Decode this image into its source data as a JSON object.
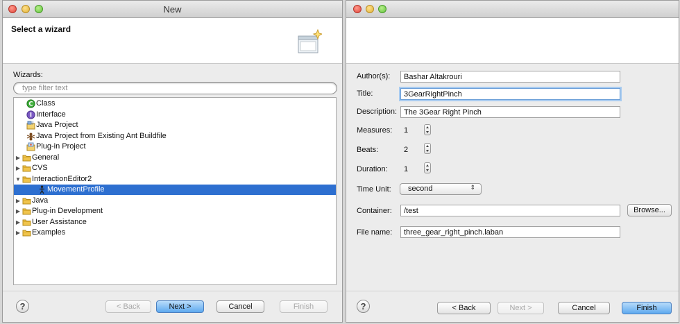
{
  "left_window": {
    "title": "New",
    "banner_title": "Select a wizard",
    "wizards_label": "Wizards:",
    "filter_placeholder": "type filter text",
    "tree": [
      {
        "label": "Class",
        "icon": "class-icon",
        "level": 1,
        "expander": "none",
        "selected": false
      },
      {
        "label": "Interface",
        "icon": "interface-icon",
        "level": 1,
        "expander": "none",
        "selected": false
      },
      {
        "label": "Java Project",
        "icon": "java-project-icon",
        "level": 1,
        "expander": "none",
        "selected": false
      },
      {
        "label": "Java Project from Existing Ant Buildfile",
        "icon": "ant-project-icon",
        "level": 1,
        "expander": "none",
        "selected": false
      },
      {
        "label": "Plug-in Project",
        "icon": "plugin-project-icon",
        "level": 1,
        "expander": "none",
        "selected": false
      },
      {
        "label": "General",
        "icon": "folder-icon",
        "level": 0,
        "expander": "collapsed",
        "selected": false
      },
      {
        "label": "CVS",
        "icon": "folder-icon",
        "level": 0,
        "expander": "collapsed",
        "selected": false
      },
      {
        "label": "InteractionEditor2",
        "icon": "folder-icon",
        "level": 0,
        "expander": "expanded",
        "selected": false
      },
      {
        "label": "MovementProfile",
        "icon": "figure-icon",
        "level": 2,
        "expander": "none",
        "selected": true
      },
      {
        "label": "Java",
        "icon": "folder-icon",
        "level": 0,
        "expander": "collapsed",
        "selected": false
      },
      {
        "label": "Plug-in Development",
        "icon": "folder-icon",
        "level": 0,
        "expander": "collapsed",
        "selected": false
      },
      {
        "label": "User Assistance",
        "icon": "folder-icon",
        "level": 0,
        "expander": "collapsed",
        "selected": false
      },
      {
        "label": "Examples",
        "icon": "folder-icon",
        "level": 0,
        "expander": "collapsed",
        "selected": false
      }
    ],
    "buttons": {
      "help": "?",
      "back": "< Back",
      "next": "Next >",
      "cancel": "Cancel",
      "finish": "Finish"
    }
  },
  "right_window": {
    "fields": {
      "author_label": "Author(s):",
      "author_value": "Bashar Altakrouri",
      "title_label": "Title:",
      "title_value": "3GearRightPinch",
      "description_label": "Description:",
      "description_value": "The 3Gear Right Pinch",
      "measures_label": "Measures:",
      "measures_value": "1",
      "beats_label": "Beats:",
      "beats_value": "2",
      "duration_label": "Duration:",
      "duration_value": "1",
      "time_unit_label": "Time Unit:",
      "time_unit_value": "second",
      "container_label": "Container:",
      "container_value": "/test",
      "browse_label": "Browse...",
      "filename_label": "File name:",
      "filename_value": "three_gear_right_pinch.laban"
    },
    "buttons": {
      "help": "?",
      "back": "< Back",
      "next": "Next >",
      "cancel": "Cancel",
      "finish": "Finish"
    }
  },
  "colors": {
    "selection": "#2d6fd0",
    "default_button": "#5ea9ef",
    "folder": "#e8b93a"
  }
}
